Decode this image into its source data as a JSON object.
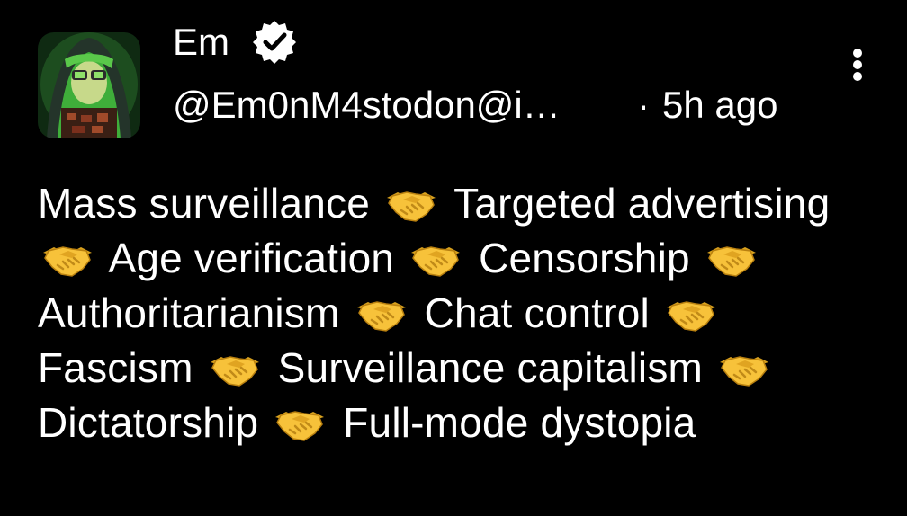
{
  "post": {
    "author": {
      "display_name": "Em",
      "handle": "@Em0nM4stodon@i…",
      "verified": true,
      "avatar_icon": "avatar-icon"
    },
    "separator": "·",
    "timestamp": "5h ago",
    "menu_icon": "more-vertical-icon",
    "body_segments": [
      "Mass surveillance",
      "Targeted advertising",
      "Age verification",
      "Censorship",
      "Authoritarianism",
      "Chat control",
      "Fascism",
      "Surveillance capitalism",
      "Dictatorship",
      "Full-mode dystopia"
    ],
    "joiner_emoji": "🤝",
    "joiner_icon": "handshake-emoji-icon"
  },
  "colors": {
    "background": "#000000",
    "text": "#ffffff",
    "emoji_yellow": "#f7c23a"
  }
}
